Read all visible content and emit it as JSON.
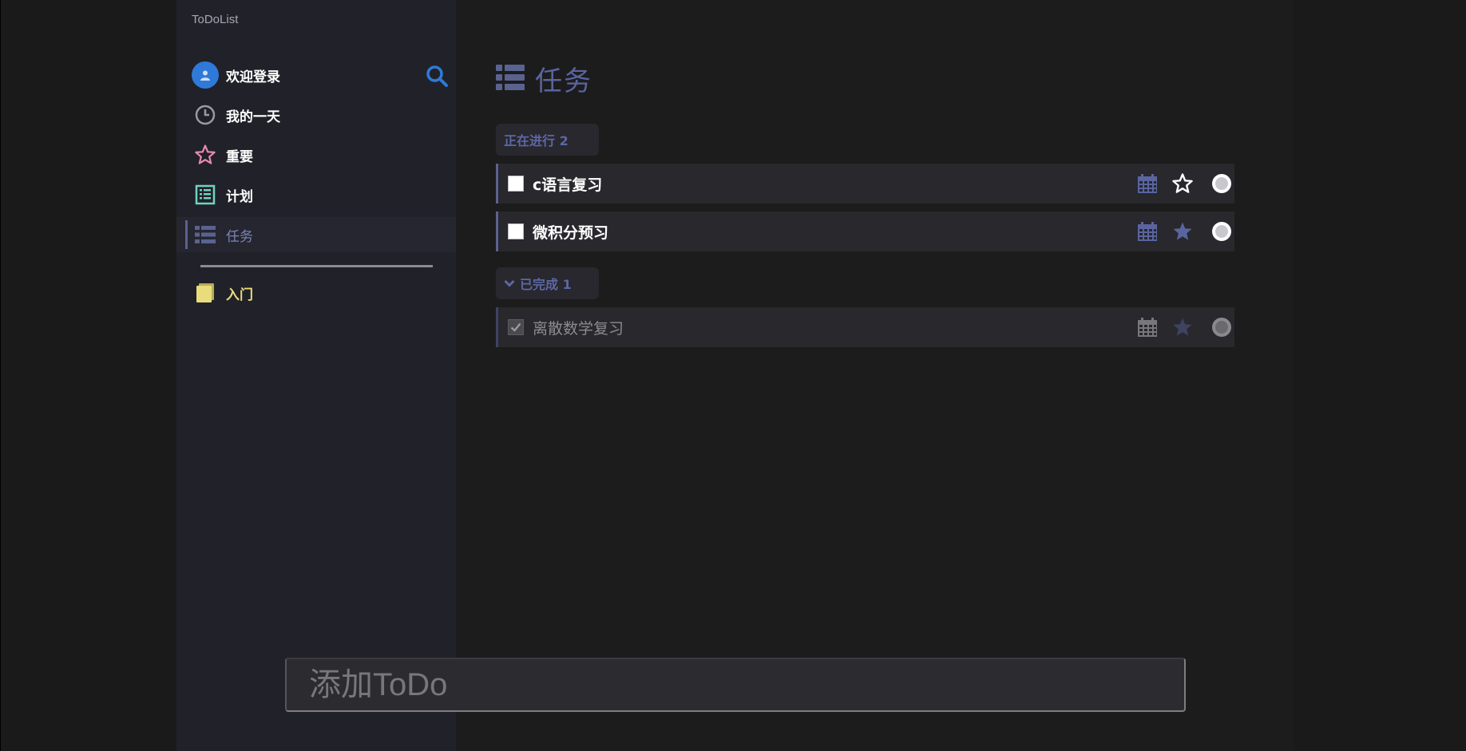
{
  "app": {
    "title": "ToDoList"
  },
  "sidebar": {
    "user_label": "欢迎登录",
    "items": [
      {
        "label": "我的一天",
        "icon": "clock-icon"
      },
      {
        "label": "重要",
        "icon": "star-outline-icon"
      },
      {
        "label": "计划",
        "icon": "calendar-list-icon"
      },
      {
        "label": "任务",
        "icon": "task-list-icon",
        "active": true
      },
      {
        "label": "入门",
        "icon": "notebook-icon"
      }
    ]
  },
  "main": {
    "title": "任务",
    "title_icon": "task-list-icon",
    "sections": {
      "in_progress": "正在进行 2",
      "completed": "已完成 1"
    },
    "tasks": [
      {
        "title": "c语言复习",
        "done": false,
        "important": false
      },
      {
        "title": "微积分预习",
        "done": false,
        "important": true
      },
      {
        "title": "离散数学复习",
        "done": true,
        "important": true
      }
    ]
  },
  "add_todo": {
    "placeholder": "添加ToDo"
  },
  "colors": {
    "accent": "#5a64a0",
    "sidebar_bg": "#212129",
    "main_bg": "#1c1c1d",
    "avatar_blue": "#2f7ad8",
    "important_star": "#5a64a0",
    "pink_star": "#e88cad",
    "calendar_green": "#6fd3c0",
    "notebook_yellow": "#e9dc7c"
  }
}
